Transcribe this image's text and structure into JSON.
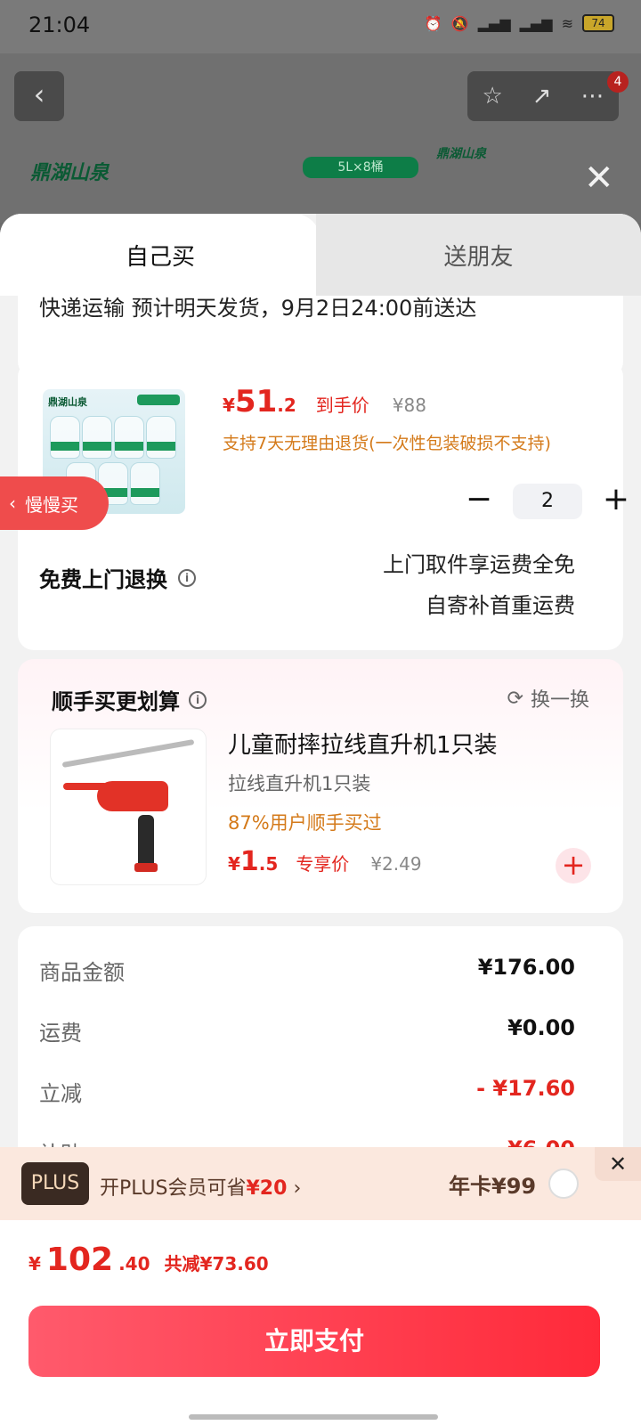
{
  "status_bar": {
    "time": "21:04",
    "battery": "74"
  },
  "background": {
    "brand_left": "鼎湖山泉",
    "spec_tag": "5L×8桶",
    "brand_right": "鼎湖山泉",
    "cart_badge": "4"
  },
  "tabs": [
    {
      "label": "自己买",
      "active": true
    },
    {
      "label": "送朋友",
      "active": false
    }
  ],
  "delivery": {
    "text": "快递运输 预计明天发货，9月2日24:00前送达"
  },
  "product": {
    "thumb_brand": "鼎湖山泉",
    "price_yen": "¥",
    "price_int": "51",
    "price_dec": ".2",
    "price_tag": "到手价",
    "original_price": "¥88",
    "return_policy": "支持7天无理由退货(一次性包装破损不支持)",
    "quantity": "2",
    "free_return_label": "免费上门退换",
    "return_note_1": "上门取件享运费全免",
    "return_note_2": "自寄补首重运费"
  },
  "slow_buy": {
    "label": "慢慢买"
  },
  "addon": {
    "title": "顺手买更划算",
    "swap": "换一换",
    "name": "儿童耐摔拉线直升机1只装",
    "sub": "拉线直升机1只装",
    "bought": "87%用户顺手买过",
    "price_yen": "¥",
    "price_int": "1",
    "price_dec": ".5",
    "price_tag": "专享价",
    "original_price": "¥2.49"
  },
  "summary": {
    "rows": [
      {
        "label": "商品金额",
        "value": "¥176.00"
      },
      {
        "label": "运费",
        "value": "¥0.00"
      },
      {
        "label": "立减",
        "value": "- ¥17.60"
      },
      {
        "label": "补贴",
        "value": "¥6.00"
      }
    ]
  },
  "plus": {
    "badge": "PLUS",
    "text_pre": "开PLUS会员可省",
    "save_amount": "¥20",
    "chevron": "›",
    "annual": "年卡¥99"
  },
  "bottom": {
    "yen": "¥",
    "total_int": "102",
    "total_dec": ".40",
    "saved": "共减¥73.60",
    "pay_button": "立即支付"
  }
}
